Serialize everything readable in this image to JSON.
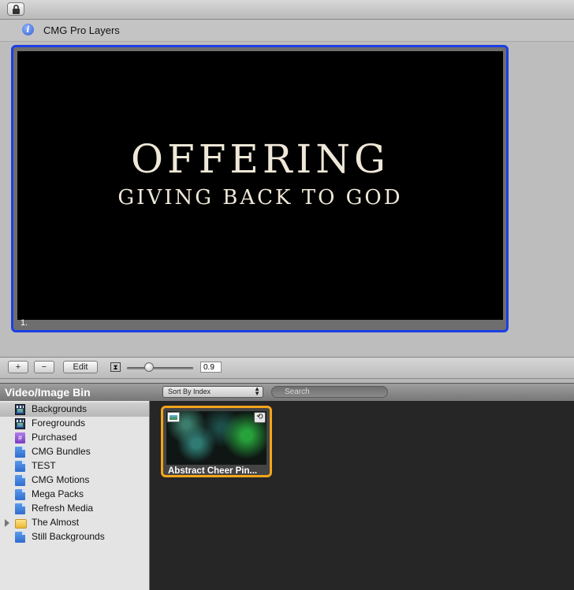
{
  "window": {
    "title": "CMG Pro Layers"
  },
  "slide": {
    "title": "OFFERING",
    "subtitle": "GIVING BACK TO GOD",
    "number": "1."
  },
  "toolbar": {
    "add_label": "+",
    "remove_label": "−",
    "edit_label": "Edit",
    "zoom_value": "0.9",
    "zoom_level": 0.3
  },
  "bin": {
    "title": "Video/Image Bin",
    "sort_selected": "Sort By Index",
    "search_placeholder": "Search",
    "sidebar_items": [
      {
        "label": "Backgrounds",
        "icon": "film-icon",
        "selected": true
      },
      {
        "label": "Foregrounds",
        "icon": "film-icon",
        "selected": false
      },
      {
        "label": "Purchased",
        "icon": "purchased-icon",
        "selected": false
      },
      {
        "label": "CMG Bundles",
        "icon": "document-icon",
        "selected": false
      },
      {
        "label": "TEST",
        "icon": "document-icon",
        "selected": false
      },
      {
        "label": "CMG Motions",
        "icon": "document-icon",
        "selected": false
      },
      {
        "label": "Mega Packs",
        "icon": "document-icon",
        "selected": false
      },
      {
        "label": "Refresh Media",
        "icon": "document-icon",
        "selected": false
      },
      {
        "label": "The Almost",
        "icon": "folder-icon",
        "selected": false
      },
      {
        "label": "Still Backgrounds",
        "icon": "document-icon",
        "selected": false
      }
    ],
    "items": [
      {
        "label": "Abstract Cheer Pin..."
      }
    ]
  },
  "colors": {
    "selection_border": "#1d3fe6",
    "thumb_highlight": "#f3a51a",
    "slide_text": "#efe8d8"
  }
}
